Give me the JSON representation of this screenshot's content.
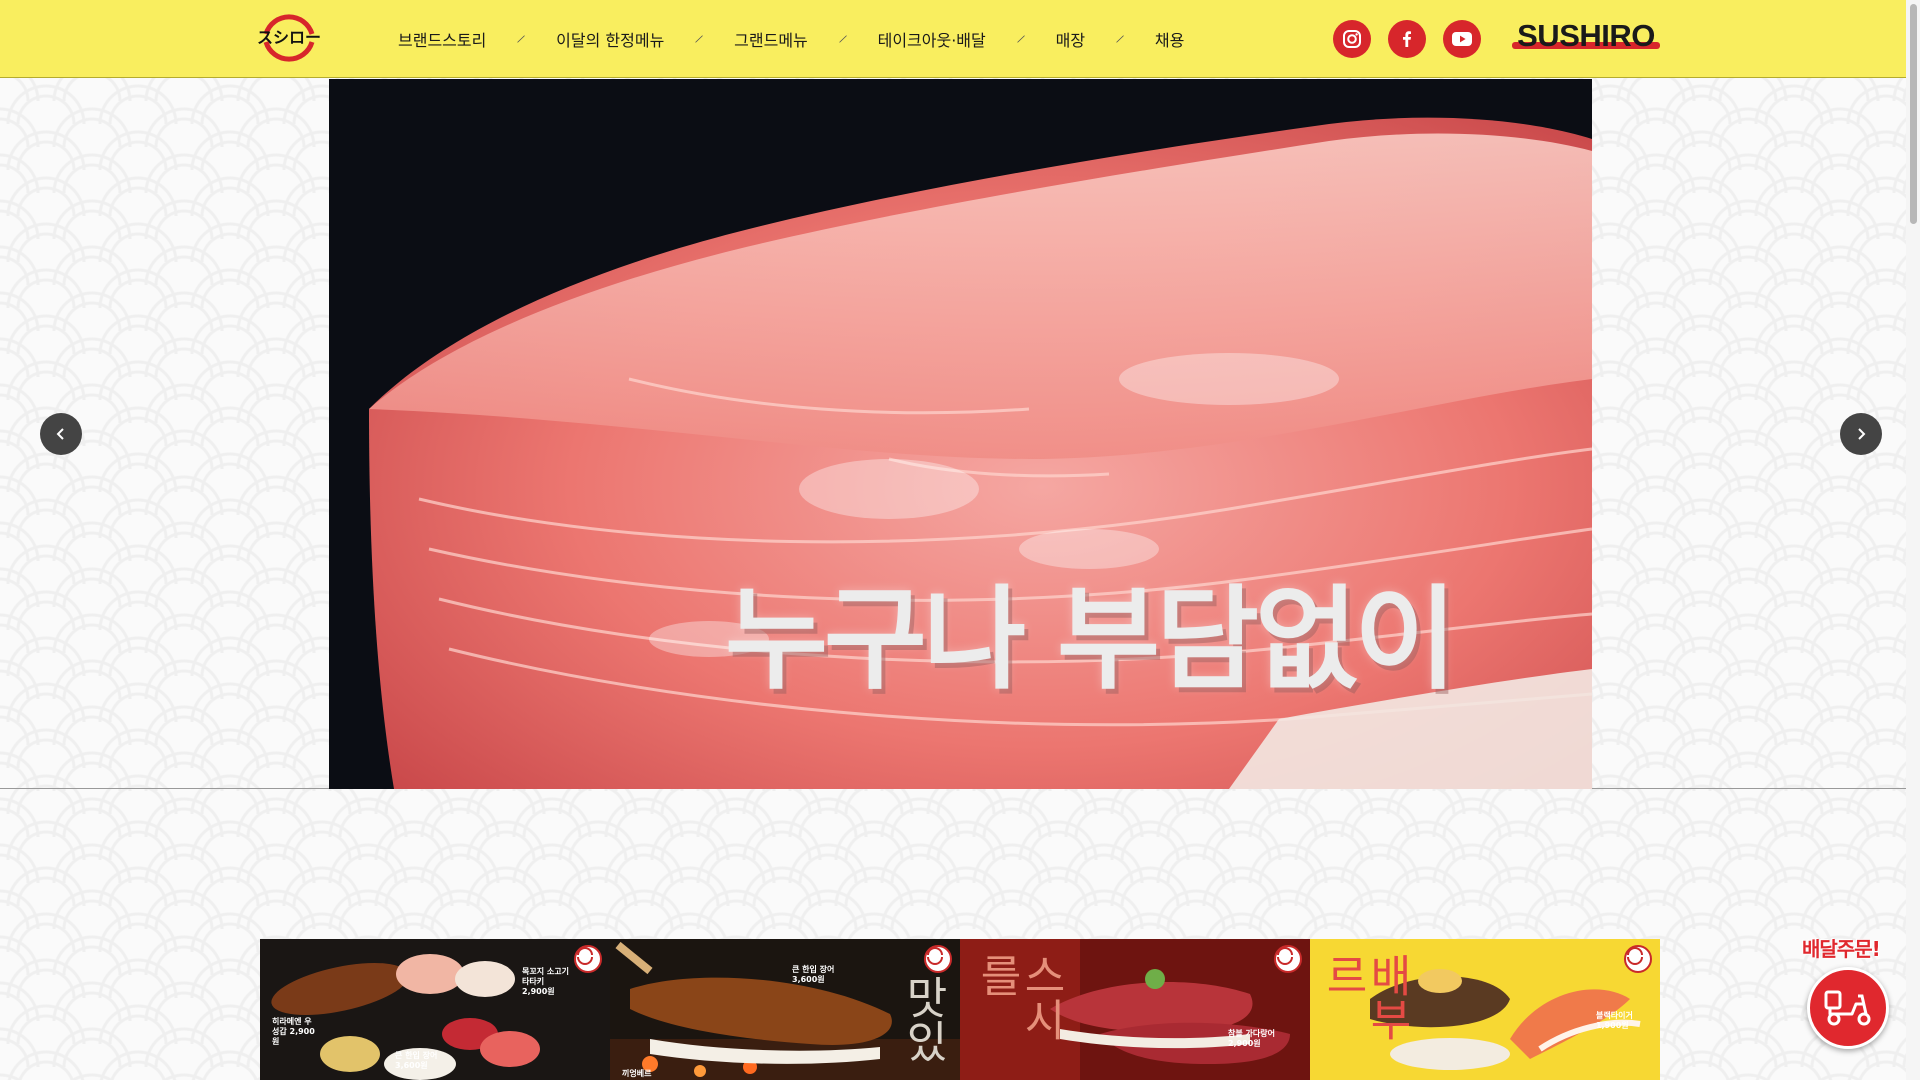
{
  "header": {
    "nav": [
      {
        "label": "브랜드스토리"
      },
      {
        "label": "이달의 한정메뉴"
      },
      {
        "label": "그랜드메뉴"
      },
      {
        "label": "테이크아웃·배달"
      },
      {
        "label": "매장"
      },
      {
        "label": "채용"
      }
    ],
    "separator": "⁄",
    "social": [
      "instagram-icon",
      "facebook-icon",
      "youtube-icon"
    ],
    "brand_text": "SUSHIRO",
    "logo_text": "スシロー"
  },
  "hero": {
    "caption": "누구나 부담없이",
    "prev_icon": "chevron-left-icon",
    "next_icon": "chevron-right-icon"
  },
  "cards": [
    {
      "tags": [
        "목꼬지 소고기 타타키 2,900원",
        "히라메엔 우성갑 2,900원",
        "큰 한입 장어 3,600원"
      ]
    },
    {
      "tags": [
        "큰 한입 장어 3,600원",
        "끼엉베르"
      ],
      "vertical_text": "맛있"
    },
    {
      "tags": [
        "참볼 가다랑어 2,900원"
      ],
      "vertical_text": "스시를"
    },
    {
      "tags": [
        "블랙타이거 1,900원"
      ],
      "vertical_text": "배부르"
    }
  ],
  "delivery": {
    "label": "배달주문!",
    "icon": "delivery-scooter-icon"
  },
  "colors": {
    "header_bg": "#f9ee5f",
    "accent_red": "#d7262b",
    "delivery_red": "#e0282e"
  }
}
